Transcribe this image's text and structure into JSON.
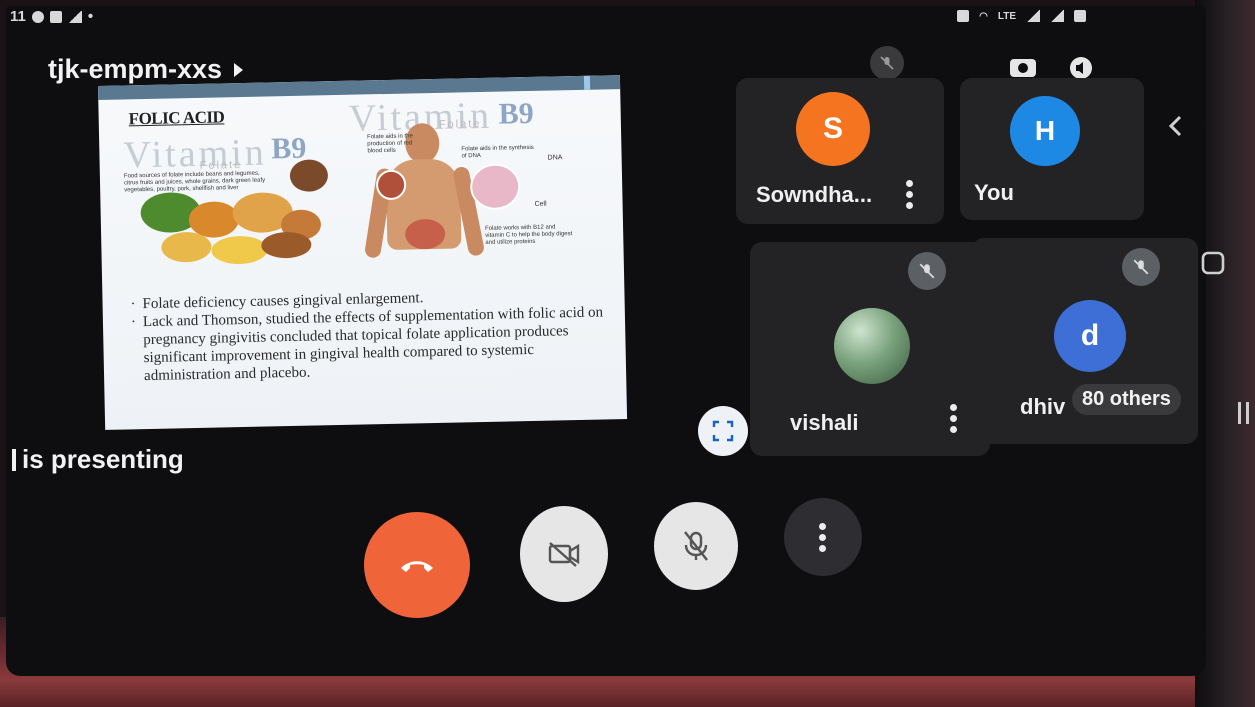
{
  "status_bar": {
    "time": "11",
    "right_text": "LTE"
  },
  "meeting": {
    "code": "tjk-empm-xxs"
  },
  "presenting": {
    "text": "is presenting"
  },
  "slide": {
    "title": "FOLIC ACID",
    "watermark_left": "Vitamin",
    "watermark_left_sub": "Folate",
    "watermark_right": "Vitamin",
    "watermark_right_sub": "Folate",
    "b9": "B9",
    "food_caption": "Food sources of folate include beans and legumes, citrus fruits and juices, whole grains, dark green leafy vegetables, poultry, pork, shellfish and liver",
    "caption_blood": "Folate aids in the production of red blood cells",
    "caption_dna": "Folate aids in the synthesis of DNA",
    "label_dna": "DNA",
    "label_cell": "Cell",
    "caption_b12": "Folate works with B12 and vitamin C to help the body digest and utilize proteins",
    "bullets": [
      "Folate deficiency causes gingival enlargement.",
      "Lack and Thomson, studied the effects of supplementation with folic acid on pregnancy gingivitis concluded that topical folate application produces significant improvement in gingival health compared to systemic administration and placebo."
    ]
  },
  "participants": [
    {
      "initial": "S",
      "name": "Sowndha...",
      "color": "#f4741f"
    },
    {
      "initial": "H",
      "name": "You",
      "color": "#1e88e5"
    },
    {
      "initial": "",
      "name": "vishali",
      "color": "#6a8a6e"
    },
    {
      "initial": "d",
      "name": "dhiv",
      "color": "#3d6fd6"
    }
  ],
  "others_badge": "80 others",
  "controls": {
    "end_call": {
      "icon": "phone-hangup-icon",
      "color": "#f0643a"
    },
    "camera": {
      "icon": "camera-off-icon",
      "color": "#e6e6e6"
    },
    "mic": {
      "icon": "mic-off-icon",
      "color": "#e6e6e6"
    },
    "more": {
      "icon": "more-vert-icon",
      "color": "#2e2e32"
    }
  },
  "icons": {
    "top_tile_mute": "mic-off-icon",
    "switch_camera": "switch-camera-icon",
    "speaker": "speaker-icon",
    "back": "chevron-left-icon",
    "home": "home-square-icon",
    "recents": "recents-icon"
  }
}
